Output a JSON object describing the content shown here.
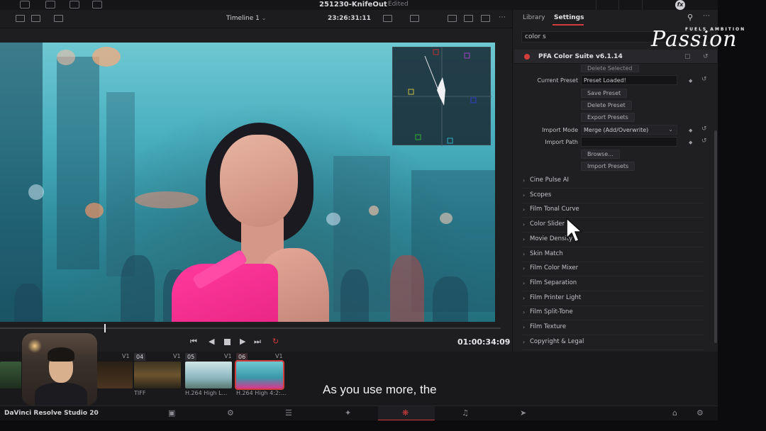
{
  "topbar": {
    "project_title": "251230-KnifeOut",
    "project_status": "Edited"
  },
  "viewer_toolbar": {
    "timeline_name": "Timeline 1",
    "timecode": "23:26:31:11"
  },
  "transport": {
    "timecode": "01:00:34:09"
  },
  "panel": {
    "tabs": [
      "Library",
      "Settings"
    ],
    "active_tab": "Settings",
    "search_value": "color s",
    "plugin_title": "PFA Color Suite v6.1.14",
    "rows": {
      "delete_selected": "Delete Selected",
      "current_preset_label": "Current Preset",
      "current_preset_value": "Preset Loaded!",
      "save_preset": "Save Preset",
      "delete_preset": "Delete Preset",
      "export_presets": "Export Presets",
      "import_mode_label": "Import Mode",
      "import_mode_value": "Merge (Add/Overwrite)",
      "import_path_label": "Import Path",
      "import_path_value": "",
      "browse": "Browse...",
      "import_presets": "Import Presets"
    },
    "sections": [
      "Cine Pulse AI",
      "Scopes",
      "Film Tonal Curve",
      "Color Slider",
      "Movie Density",
      "Skin Match",
      "Film Color Mixer",
      "Film Separation",
      "Film Printer Light",
      "Film Split-Tone",
      "Film Texture",
      "Copyright & Legal"
    ]
  },
  "clips": [
    {
      "num": "",
      "track": "V1",
      "caption": ""
    },
    {
      "num": "04",
      "track": "V1",
      "caption": "TIFF"
    },
    {
      "num": "05",
      "track": "V1",
      "caption": "H.264 High L..."
    },
    {
      "num": "06",
      "track": "V1",
      "caption": "H.264 High 4:2:..."
    }
  ],
  "subtitle": "As you use more, the",
  "bottombar": {
    "app_name": "DaVinci Resolve Studio 20"
  },
  "logo": {
    "small": "FUELS AMBITION",
    "script": "Passion"
  },
  "colors": {
    "accent": "#d23c3c",
    "dress": "#ff3a9c",
    "sky": "#48aebe"
  }
}
